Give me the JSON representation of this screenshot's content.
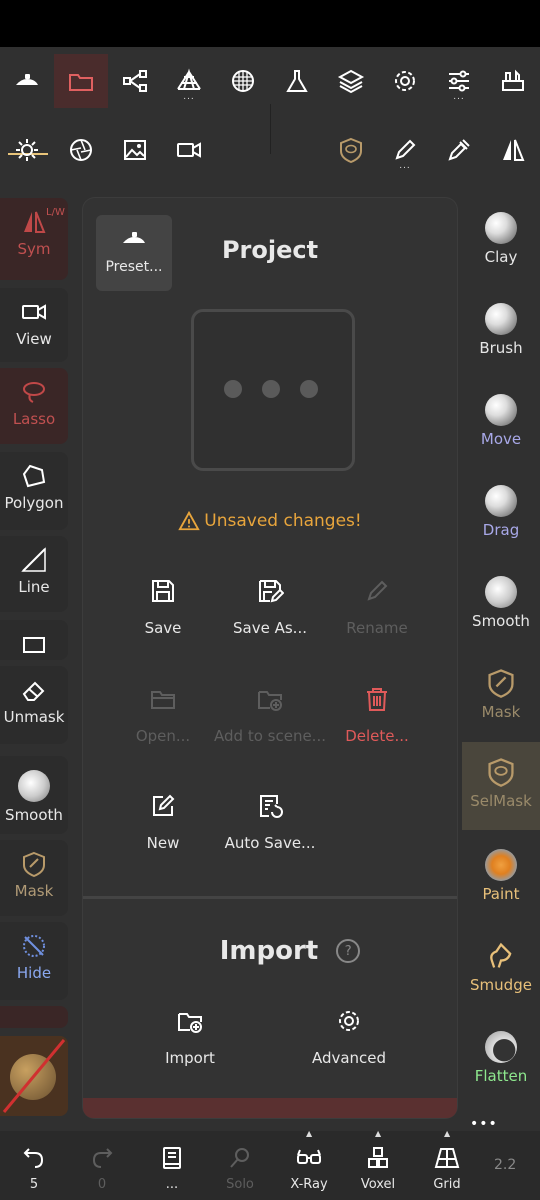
{
  "top_toolbar": {
    "items": [
      {
        "icon": "sculpt-icon"
      },
      {
        "icon": "folder-icon"
      },
      {
        "icon": "scene-graph-icon"
      },
      {
        "icon": "topology-icon",
        "more": "..."
      },
      {
        "icon": "mesh-sphere-icon"
      },
      {
        "icon": "flask-icon"
      },
      {
        "icon": "layers-icon"
      },
      {
        "icon": "settings-icon"
      },
      {
        "icon": "sliders-icon",
        "more": "..."
      },
      {
        "icon": "toolbox-icon"
      }
    ],
    "row2": [
      {
        "icon": "light-icon"
      },
      {
        "icon": "shader-icon"
      },
      {
        "icon": "image-icon"
      },
      {
        "icon": "camera-icon"
      },
      {
        "icon": "selmask-tool-icon"
      },
      {
        "icon": "pen-icon",
        "more": "..."
      },
      {
        "icon": "picker-icon"
      },
      {
        "icon": "symmetry-icon"
      }
    ]
  },
  "left_tools": {
    "sym": {
      "label": "Sym",
      "badge": "L/W"
    },
    "view": {
      "label": "View"
    },
    "lasso": {
      "label": "Lasso"
    },
    "polygon": {
      "label": "Polygon"
    },
    "line": {
      "label": "Line"
    },
    "unmask": {
      "label": "Unmask"
    },
    "smooth": {
      "label": "Smooth"
    },
    "mask": {
      "label": "Mask"
    },
    "hide": {
      "label": "Hide"
    }
  },
  "right_tools": [
    {
      "label": "Clay",
      "color": "#e6e6e6"
    },
    {
      "label": "Brush",
      "color": "#e6e6e6"
    },
    {
      "label": "Move",
      "color": "#a8a8e8"
    },
    {
      "label": "Drag",
      "color": "#a8a8e8"
    },
    {
      "label": "Smooth",
      "color": "#e6e6e6"
    },
    {
      "label": "Mask",
      "color": "#9a8a6a"
    },
    {
      "label": "SelMask",
      "color": "#9a8a6a"
    },
    {
      "label": "Paint",
      "color": "#e8c07a"
    },
    {
      "label": "Smudge",
      "color": "#e8c07a"
    },
    {
      "label": "Flatten",
      "color": "#8ee88e"
    }
  ],
  "panel": {
    "preset_label": "Preset...",
    "title": "Project",
    "warning": "Unsaved changes!",
    "actions": {
      "save": "Save",
      "save_as": "Save As...",
      "rename": "Rename",
      "open": "Open...",
      "add_to_scene": "Add to scene...",
      "delete": "Delete...",
      "new": "New",
      "auto_save": "Auto Save..."
    },
    "import_title": "Import",
    "import_help": "?",
    "import_actions": {
      "import": "Import",
      "advanced": "Advanced"
    }
  },
  "bottom_bar": {
    "undo_count": "5",
    "redo_count": "0",
    "more": "...",
    "solo": "Solo",
    "xray": "X-Ray",
    "voxel": "Voxel",
    "grid": "Grid",
    "version": "2.2",
    "more_dots": "•••"
  },
  "colors": {
    "accent": "#e8c47a",
    "warning": "#e8a53c",
    "danger": "#e05a5a",
    "active_red": "#d9534f"
  }
}
